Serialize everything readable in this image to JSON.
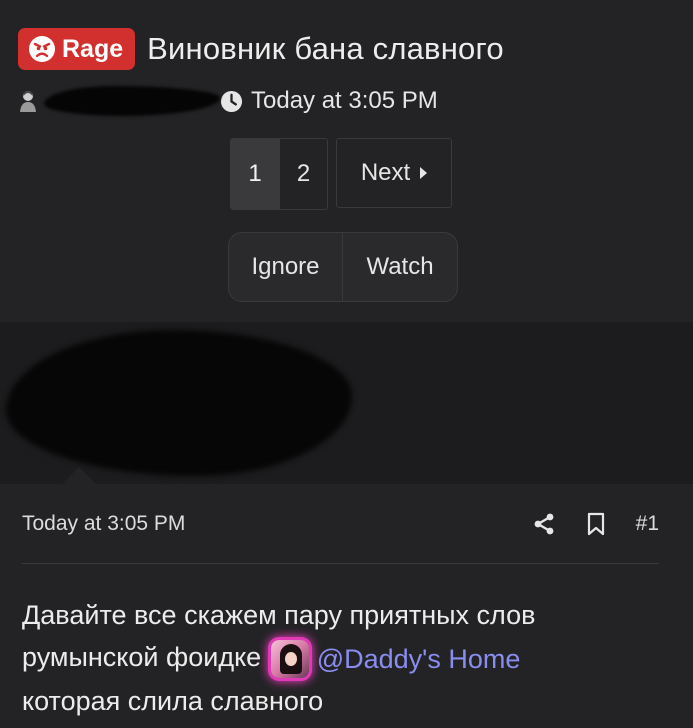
{
  "thread": {
    "prefix": "Rage",
    "title": "Виновник бана славного",
    "date": "Today at 3:05 PM"
  },
  "pagination": {
    "pages": [
      "1",
      "2"
    ],
    "current": "1",
    "next_label": "Next"
  },
  "actions": {
    "ignore_label": "Ignore",
    "watch_label": "Watch"
  },
  "post": {
    "date": "Today at 3:05 PM",
    "number": "#1",
    "body_line1": "Давайте все скажем пару приятных слов",
    "body_line2": "румынской фоидке",
    "mention": "@Daddy's Home",
    "body_line3": "которая слила славного"
  },
  "icons": {
    "prefix": "angry-face-icon",
    "author": "avatar-icon",
    "clock": "clock-icon",
    "next": "caret-right-icon",
    "share": "share-icon",
    "bookmark": "bookmark-icon"
  },
  "colors": {
    "background": "#232325",
    "prefix_bg": "#d22f2f",
    "mention": "#8a8df0",
    "avatar_glow": "#ff3fcf"
  }
}
